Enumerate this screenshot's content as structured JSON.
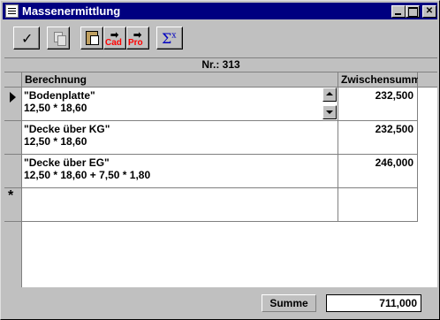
{
  "window": {
    "title": "Massenermittlung"
  },
  "toolbar": {
    "cad_label": "Cad",
    "pro_label": "Pro"
  },
  "header": {
    "number": "Nr.: 313"
  },
  "table": {
    "columns": [
      "Berechnung",
      "Zwischensumm"
    ],
    "rows": [
      {
        "line1": "\"Bodenplatte\"",
        "line2": "12,50 * 18,60",
        "value": "232,500",
        "selected": true
      },
      {
        "line1": "\"Decke über KG\"",
        "line2": "12,50 * 18,60",
        "value": "232,500",
        "selected": false
      },
      {
        "line1": "\"Decke über EG\"",
        "line2": "12,50 * 18,60 + 7,50 * 1,80",
        "value": "246,000",
        "selected": false
      }
    ],
    "new_row_marker": "*"
  },
  "footer": {
    "sum_label": "Summe",
    "sum_value": "711,000"
  },
  "icons": {
    "ok": "checkmark-icon",
    "copy": "copy-icon",
    "paste": "clipboard-icon",
    "cad": "export-cad-icon",
    "pro": "export-pro-icon",
    "sum": "sigma-icon",
    "row_current": "row-pointer-icon",
    "new_row": "new-record-icon"
  },
  "colors": {
    "titlebar": "#000080",
    "face": "#c0c0c0",
    "accent_red": "#ff0000",
    "accent_blue": "#0000c0"
  }
}
